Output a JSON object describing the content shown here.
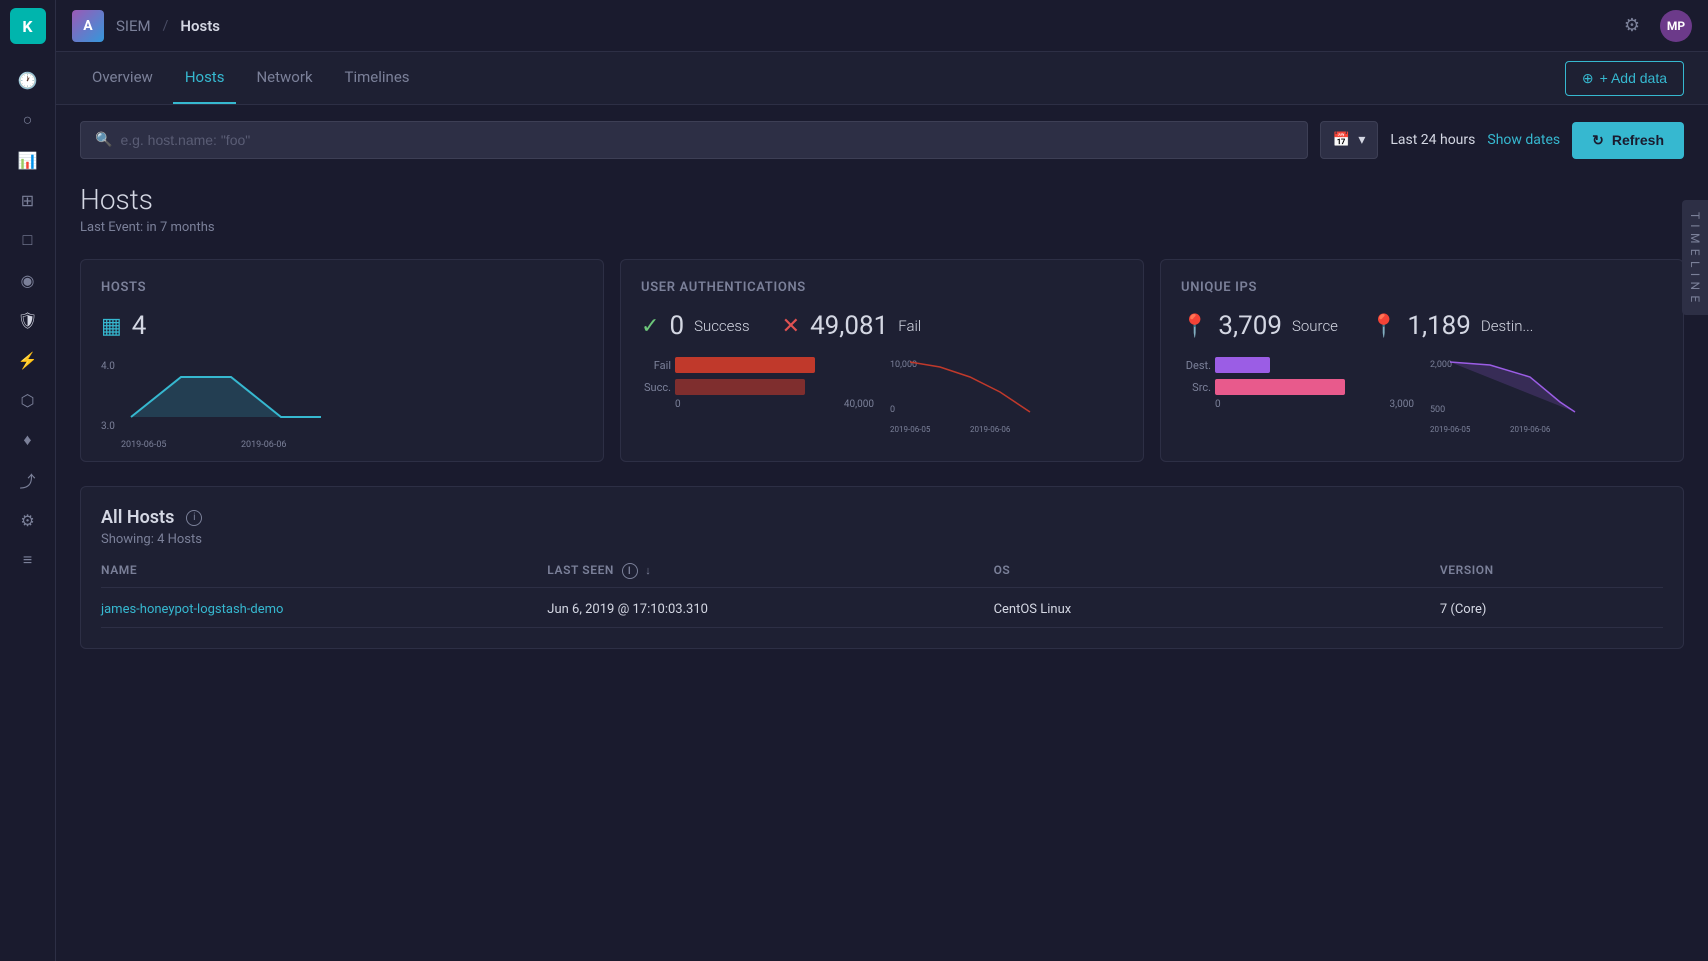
{
  "topbar": {
    "logo_text": "K",
    "app_abbr": "A",
    "siem_label": "SIEM",
    "separator": "/",
    "page_label": "Hosts",
    "gear_unicode": "⚙",
    "avatar_text": "MP"
  },
  "nav": {
    "tabs": [
      {
        "label": "Overview",
        "active": false
      },
      {
        "label": "Hosts",
        "active": true
      },
      {
        "label": "Network",
        "active": false
      },
      {
        "label": "Timelines",
        "active": false
      }
    ],
    "add_data_label": "+ Add data"
  },
  "search": {
    "placeholder": "e.g. host.name: \"foo\"",
    "time_icon": "📅",
    "time_range": "Last 24 hours",
    "show_dates_label": "Show dates",
    "refresh_label": "Refresh"
  },
  "page_header": {
    "title": "Hosts",
    "subtitle": "Last Event: in 7 months"
  },
  "hosts_card": {
    "title": "Hosts",
    "count": "4",
    "chart_dates": [
      "2019-06-05",
      "2019-06-06"
    ],
    "y_min": "3.0",
    "y_max": "4.0"
  },
  "auth_card": {
    "title": "User Authentications",
    "success_count": "0",
    "success_label": "Success",
    "fail_count": "49,081",
    "fail_label": "Fail",
    "bar_fail_label": "Fail",
    "bar_succ_label": "Succ.",
    "x_labels": [
      "0",
      "40,000"
    ],
    "chart_dates": [
      "2019-06-05",
      "2019-06-06"
    ],
    "y_max": "10,000",
    "y_min": "0"
  },
  "ips_card": {
    "title": "Unique IPs",
    "source_count": "3,709",
    "source_label": "Source",
    "dest_count": "1,189",
    "dest_label": "Destin...",
    "bar_dest_label": "Dest.",
    "bar_src_label": "Src.",
    "x_labels": [
      "0",
      "3,000"
    ],
    "chart_dates": [
      "2019-06-05",
      "2019-06-06"
    ],
    "y_max": "2,000",
    "y_min": "500"
  },
  "all_hosts": {
    "title": "All Hosts",
    "showing": "Showing: 4 Hosts",
    "columns": [
      "Name",
      "Last Seen",
      "OS",
      "Version"
    ],
    "rows": [
      {
        "name": "james-honeypot-logstash-demo",
        "last_seen": "Jun 6, 2019 @ 17:10:03.310",
        "os": "CentOS Linux",
        "version": "7 (Core)"
      }
    ]
  },
  "timeline_label": "T I M E L I N E",
  "icons": {
    "search": "🔍",
    "refresh": "↻",
    "calendar": "📅",
    "chevron_down": "▾",
    "add": "⊕",
    "host_grid": "▦",
    "checkmark": "✓",
    "x_mark": "✕",
    "pin": "📍",
    "info": "i"
  }
}
